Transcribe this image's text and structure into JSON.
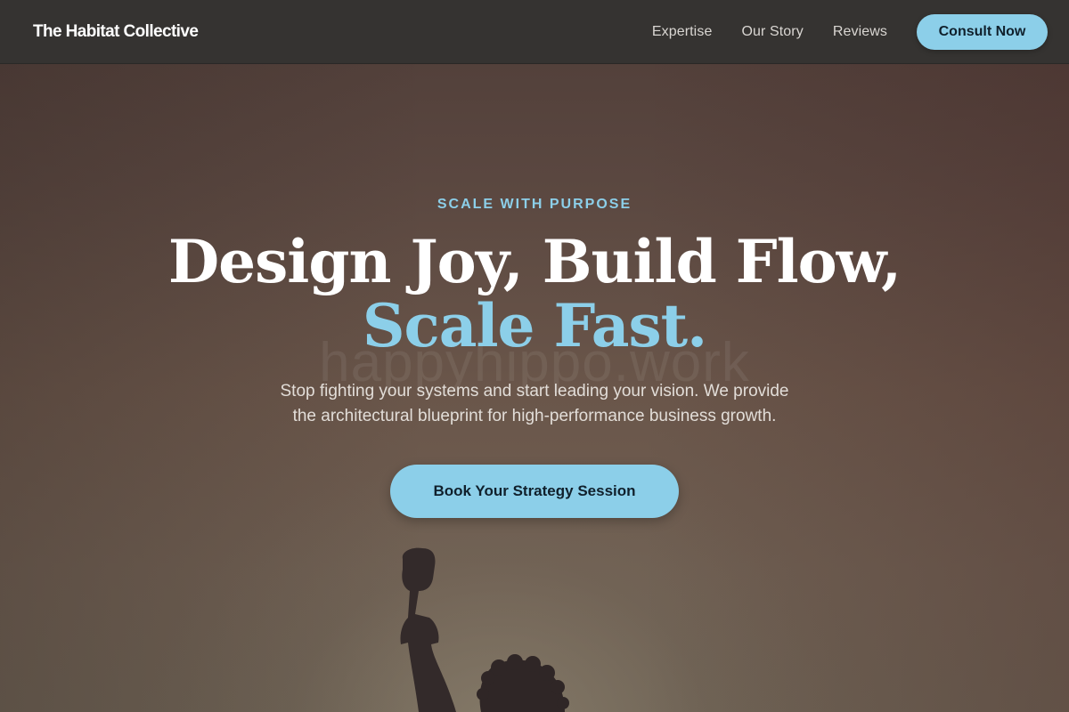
{
  "navbar": {
    "brand": "The Habitat Collective",
    "links": [
      "Expertise",
      "Our Story",
      "Reviews"
    ],
    "cta_label": "Consult Now"
  },
  "hero": {
    "eyebrow": "SCALE WITH PURPOSE",
    "headline_line1": "Design Joy, Build Flow,",
    "headline_line2": "Scale Fast.",
    "watermark": "happyhippo.work",
    "subtext_line1": "Stop fighting your systems and start leading your vision. We provide",
    "subtext_line2": "the architectural blueprint for high-performance business growth.",
    "cta_label": "Book Your Strategy Session",
    "image_icon": "raised-fist-silhouette-icon"
  },
  "colors": {
    "accent": "#8ccfe9",
    "navbar_bg": "#353331",
    "cta_text": "#10202c"
  }
}
